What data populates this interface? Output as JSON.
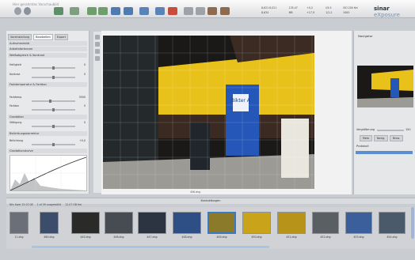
{
  "app": {
    "title": "Hier gerahmtes Vorschaubild",
    "logo_brand": "sinar",
    "logo_product": "eXposure"
  },
  "readouts": [
    "8,621 6,021 8,634",
    "135,47 MB",
    "+0,2 +17,9",
    "f/4.5 1/1.2",
    "ISO 200 Kel 3400"
  ],
  "left_panel": {
    "tabs": [
      "Voreinstellung",
      "Bearbeiten",
      "Export"
    ],
    "sections": [
      {
        "label": "Aufnahmebild"
      },
      {
        "label": "Arbeitsfarbraum"
      },
      {
        "label": "Weißabgleich & Kontrast"
      },
      {
        "label": "Farbtemperatur & Farbton"
      },
      {
        "label": "Gradation"
      },
      {
        "label": "Belichtungskorrektur"
      },
      {
        "label": "Gradationskurve"
      }
    ],
    "params": [
      {
        "label": "Helligkeit",
        "value": "0"
      },
      {
        "label": "Kontrast",
        "value": "0"
      },
      {
        "label": "Farbtemp.",
        "value": "5500"
      },
      {
        "label": "Farbton",
        "value": "0"
      },
      {
        "label": "Sättigung",
        "value": "0"
      },
      {
        "label": "Belichtung",
        "value": "+0,0"
      }
    ]
  },
  "preview": {
    "caption": "456.dng",
    "door_sign": "Bikter A"
  },
  "right_panel": {
    "navigator_title": "Navigator",
    "zoom_label": "Vergrößerung",
    "zoom_value": "100",
    "tabs": [
      "Meta",
      "Navig.",
      "Brow."
    ],
    "protocol_title": "Protokoll"
  },
  "filmstrip": {
    "header": "Kontaktbogen",
    "info": [
      "Nils Kwei 15.07.08",
      "1 of 39 ausgewählt",
      "12,07 GB frei"
    ],
    "files": [
      {
        "name": "11.dng"
      },
      {
        "name": "460.dng"
      },
      {
        "name": "445.dng"
      },
      {
        "name": "446.dng"
      },
      {
        "name": "447.dng"
      },
      {
        "name": "448.dng"
      },
      {
        "name": "449.dng"
      },
      {
        "name": "450.dng"
      },
      {
        "name": "451.dng"
      },
      {
        "name": "452.dng"
      },
      {
        "name": "453.dng"
      },
      {
        "name": "454.dng"
      }
    ]
  },
  "colors": {
    "selection": "#3a78c8",
    "facade_yellow": "#e8c21a",
    "door_blue": "#2457b8"
  }
}
